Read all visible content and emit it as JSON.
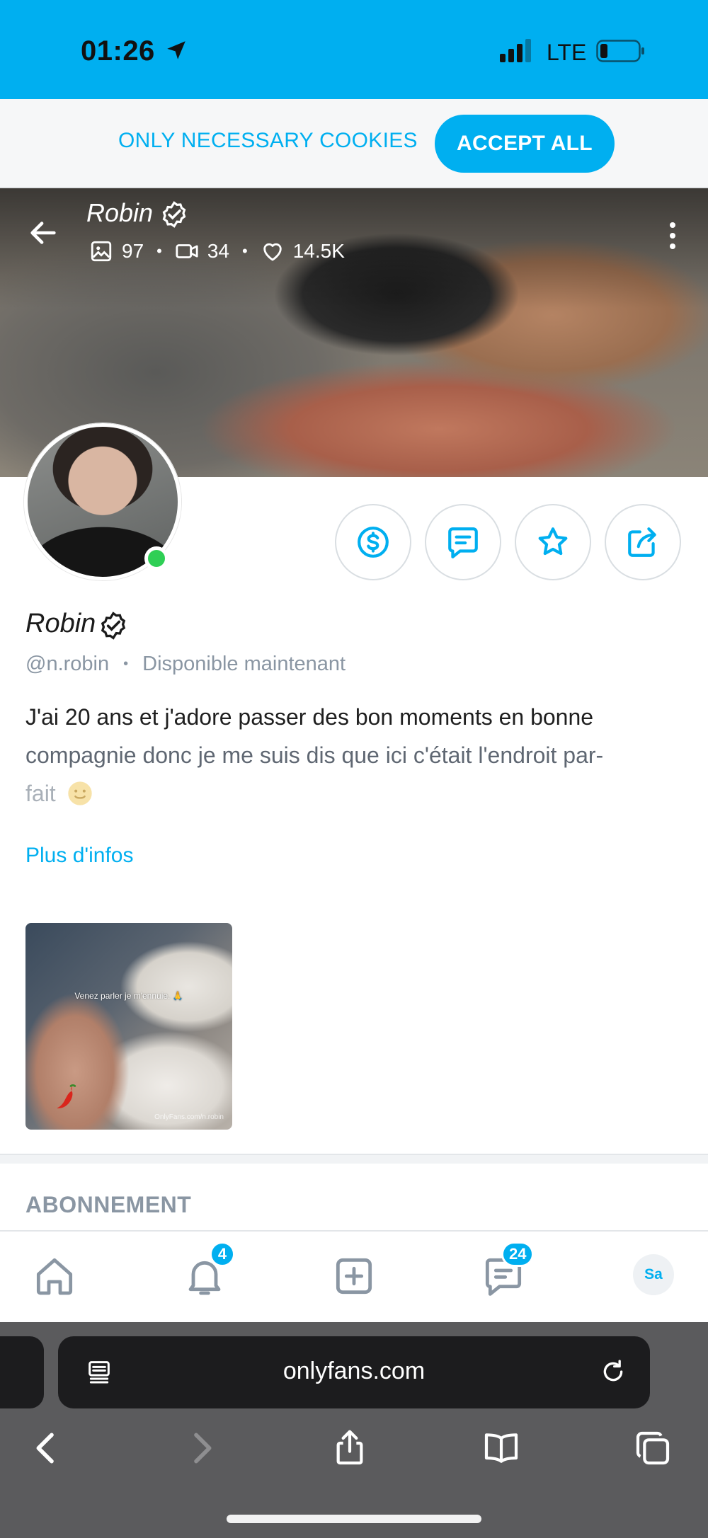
{
  "status_bar": {
    "time": "01:26",
    "network": "LTE",
    "location_icon": "location-arrow-icon",
    "signal_icon": "signal-bars-icon",
    "battery_icon": "battery-low-icon"
  },
  "cookie_banner": {
    "necessary_label": "ONLY NECESSARY COOKIES",
    "accept_label": "ACCEPT ALL"
  },
  "cover": {
    "name": "Robin",
    "stats": {
      "photos": "97",
      "videos": "34",
      "likes": "14.5K"
    }
  },
  "profile": {
    "name": "Robin",
    "handle": "@n.robin",
    "availability": "Disponible maintenant",
    "bio_lines": [
      "J'ai 20 ans et j'adore passer des bon moments en bonne",
      "compagnie donc je me suis dis que ici c'était l'endroit par-",
      "fait"
    ],
    "more_info": "Plus d'infos",
    "online": true
  },
  "media_thumb": {
    "caption": "Venez parler je m'ennuie. 🙏",
    "watermark": "OnlyFans.com/n.robin"
  },
  "section": {
    "title": "ABONNEMENT"
  },
  "bottom_nav": {
    "notifications_badge": "4",
    "messages_badge": "24",
    "avatar_initials": "Sa"
  },
  "browser": {
    "url": "onlyfans.com"
  },
  "colors": {
    "accent": "#00aff0",
    "online": "#2fcf55",
    "muted": "#8a96a3"
  }
}
